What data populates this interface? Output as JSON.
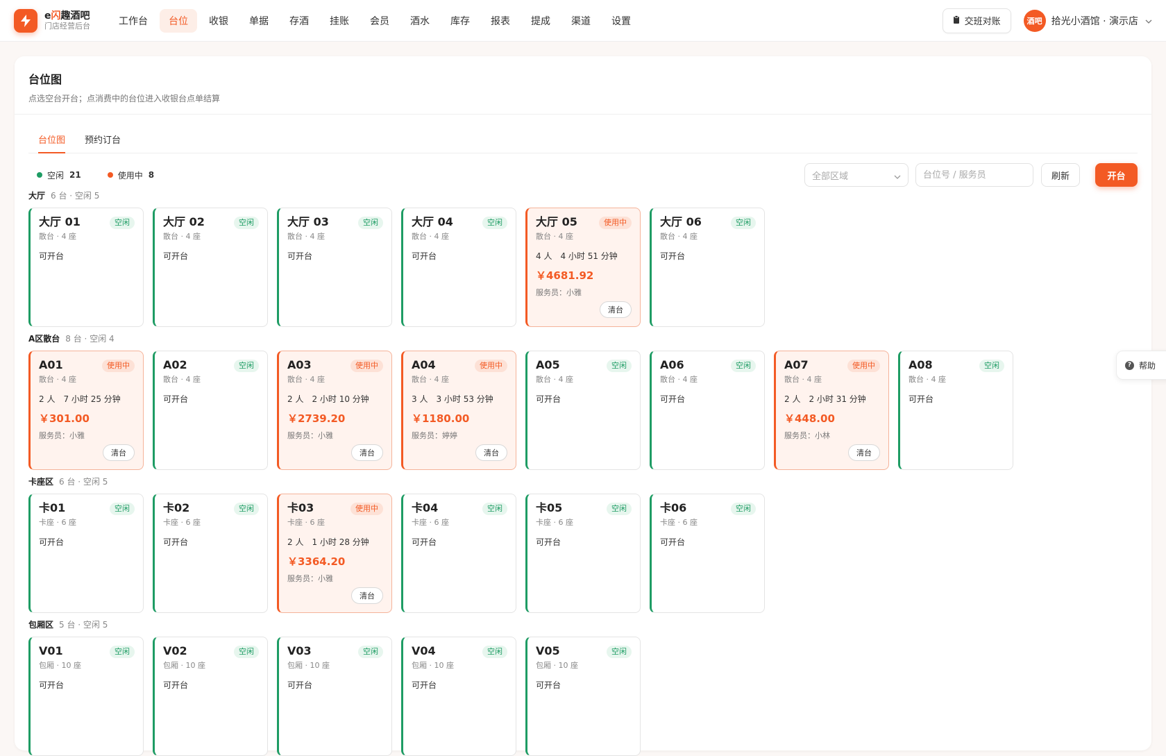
{
  "brand": {
    "name_prefix": "e",
    "name_highlight": "闪",
    "name_suffix": "趣酒吧",
    "subtitle": "门店经营后台"
  },
  "nav": [
    {
      "label": "工作台",
      "active": false
    },
    {
      "label": "台位",
      "active": true
    },
    {
      "label": "收银",
      "active": false
    },
    {
      "label": "单据",
      "active": false
    },
    {
      "label": "存酒",
      "active": false
    },
    {
      "label": "挂账",
      "active": false
    },
    {
      "label": "会员",
      "active": false
    },
    {
      "label": "酒水",
      "active": false
    },
    {
      "label": "库存",
      "active": false
    },
    {
      "label": "报表",
      "active": false
    },
    {
      "label": "提成",
      "active": false
    },
    {
      "label": "渠道",
      "active": false
    },
    {
      "label": "设置",
      "active": false
    }
  ],
  "header": {
    "shift_label": "交班对账",
    "avatar_text": "酒吧",
    "store_name": "拾光小酒馆 · 演示店"
  },
  "page": {
    "title": "台位图",
    "description": "点选空台开台；点消费中的台位进入收银台点单结算"
  },
  "tabs": [
    {
      "label": "台位图",
      "active": true
    },
    {
      "label": "预约订台",
      "active": false
    }
  ],
  "legend": {
    "free_label": "空闲",
    "free_count": "21",
    "busy_label": "使用中",
    "busy_count": "8"
  },
  "toolbar": {
    "area_placeholder": "全部区域",
    "search_placeholder": "台位号 / 服务员",
    "refresh_label": "刷新",
    "open_label": "开台"
  },
  "colors": {
    "accent": "#f35a24",
    "free": "#1e9c64",
    "busy_bg": "#fff3ee"
  },
  "clear_label": "清台",
  "zones": [
    {
      "name": "大厅",
      "summary": "6 台 · 空闲 5",
      "tables": [
        {
          "name": "大厅 01",
          "meta": "散台 · 4 座",
          "busy": false,
          "badge": "空闲",
          "status": "可开台"
        },
        {
          "name": "大厅 02",
          "meta": "散台 · 4 座",
          "busy": false,
          "badge": "空闲",
          "status": "可开台"
        },
        {
          "name": "大厅 03",
          "meta": "散台 · 4 座",
          "busy": false,
          "badge": "空闲",
          "status": "可开台"
        },
        {
          "name": "大厅 04",
          "meta": "散台 · 4 座",
          "busy": false,
          "badge": "空闲",
          "status": "可开台"
        },
        {
          "name": "大厅 05",
          "meta": "散台 · 4 座",
          "busy": true,
          "badge": "使用中",
          "status": "4 人　4 小时 51 分钟",
          "amount": "￥4681.92",
          "waiter": "服务员：小雅"
        },
        {
          "name": "大厅 06",
          "meta": "散台 · 4 座",
          "busy": false,
          "badge": "空闲",
          "status": "可开台"
        }
      ]
    },
    {
      "name": "A区散台",
      "summary": "8 台 · 空闲 4",
      "tables": [
        {
          "name": "A01",
          "meta": "散台 · 4 座",
          "busy": true,
          "badge": "使用中",
          "status": "2 人　7 小时 25 分钟",
          "amount": "￥301.00",
          "waiter": "服务员：小雅"
        },
        {
          "name": "A02",
          "meta": "散台 · 4 座",
          "busy": false,
          "badge": "空闲",
          "status": "可开台"
        },
        {
          "name": "A03",
          "meta": "散台 · 4 座",
          "busy": true,
          "badge": "使用中",
          "status": "2 人　2 小时 10 分钟",
          "amount": "￥2739.20",
          "waiter": "服务员：小雅"
        },
        {
          "name": "A04",
          "meta": "散台 · 4 座",
          "busy": true,
          "badge": "使用中",
          "status": "3 人　3 小时 53 分钟",
          "amount": "￥1180.00",
          "waiter": "服务员：婷婷"
        },
        {
          "name": "A05",
          "meta": "散台 · 4 座",
          "busy": false,
          "badge": "空闲",
          "status": "可开台"
        },
        {
          "name": "A06",
          "meta": "散台 · 4 座",
          "busy": false,
          "badge": "空闲",
          "status": "可开台"
        },
        {
          "name": "A07",
          "meta": "散台 · 4 座",
          "busy": true,
          "badge": "使用中",
          "status": "2 人　2 小时 31 分钟",
          "amount": "￥448.00",
          "waiter": "服务员：小林"
        },
        {
          "name": "A08",
          "meta": "散台 · 4 座",
          "busy": false,
          "badge": "空闲",
          "status": "可开台"
        }
      ]
    },
    {
      "name": "卡座区",
      "summary": "6 台 · 空闲 5",
      "tables": [
        {
          "name": "卡01",
          "meta": "卡座 · 6 座",
          "busy": false,
          "badge": "空闲",
          "status": "可开台"
        },
        {
          "name": "卡02",
          "meta": "卡座 · 6 座",
          "busy": false,
          "badge": "空闲",
          "status": "可开台"
        },
        {
          "name": "卡03",
          "meta": "卡座 · 6 座",
          "busy": true,
          "badge": "使用中",
          "status": "2 人　1 小时 28 分钟",
          "amount": "￥3364.20",
          "waiter": "服务员：小雅"
        },
        {
          "name": "卡04",
          "meta": "卡座 · 6 座",
          "busy": false,
          "badge": "空闲",
          "status": "可开台"
        },
        {
          "name": "卡05",
          "meta": "卡座 · 6 座",
          "busy": false,
          "badge": "空闲",
          "status": "可开台"
        },
        {
          "name": "卡06",
          "meta": "卡座 · 6 座",
          "busy": false,
          "badge": "空闲",
          "status": "可开台"
        }
      ]
    },
    {
      "name": "包厢区",
      "summary": "5 台 · 空闲 5",
      "tables": [
        {
          "name": "V01",
          "meta": "包厢 · 10 座",
          "busy": false,
          "badge": "空闲",
          "status": "可开台"
        },
        {
          "name": "V02",
          "meta": "包厢 · 10 座",
          "busy": false,
          "badge": "空闲",
          "status": "可开台"
        },
        {
          "name": "V03",
          "meta": "包厢 · 10 座",
          "busy": false,
          "badge": "空闲",
          "status": "可开台"
        },
        {
          "name": "V04",
          "meta": "包厢 · 10 座",
          "busy": false,
          "badge": "空闲",
          "status": "可开台"
        },
        {
          "name": "V05",
          "meta": "包厢 · 10 座",
          "busy": false,
          "badge": "空闲",
          "status": "可开台"
        }
      ]
    }
  ],
  "help_label": "帮助"
}
